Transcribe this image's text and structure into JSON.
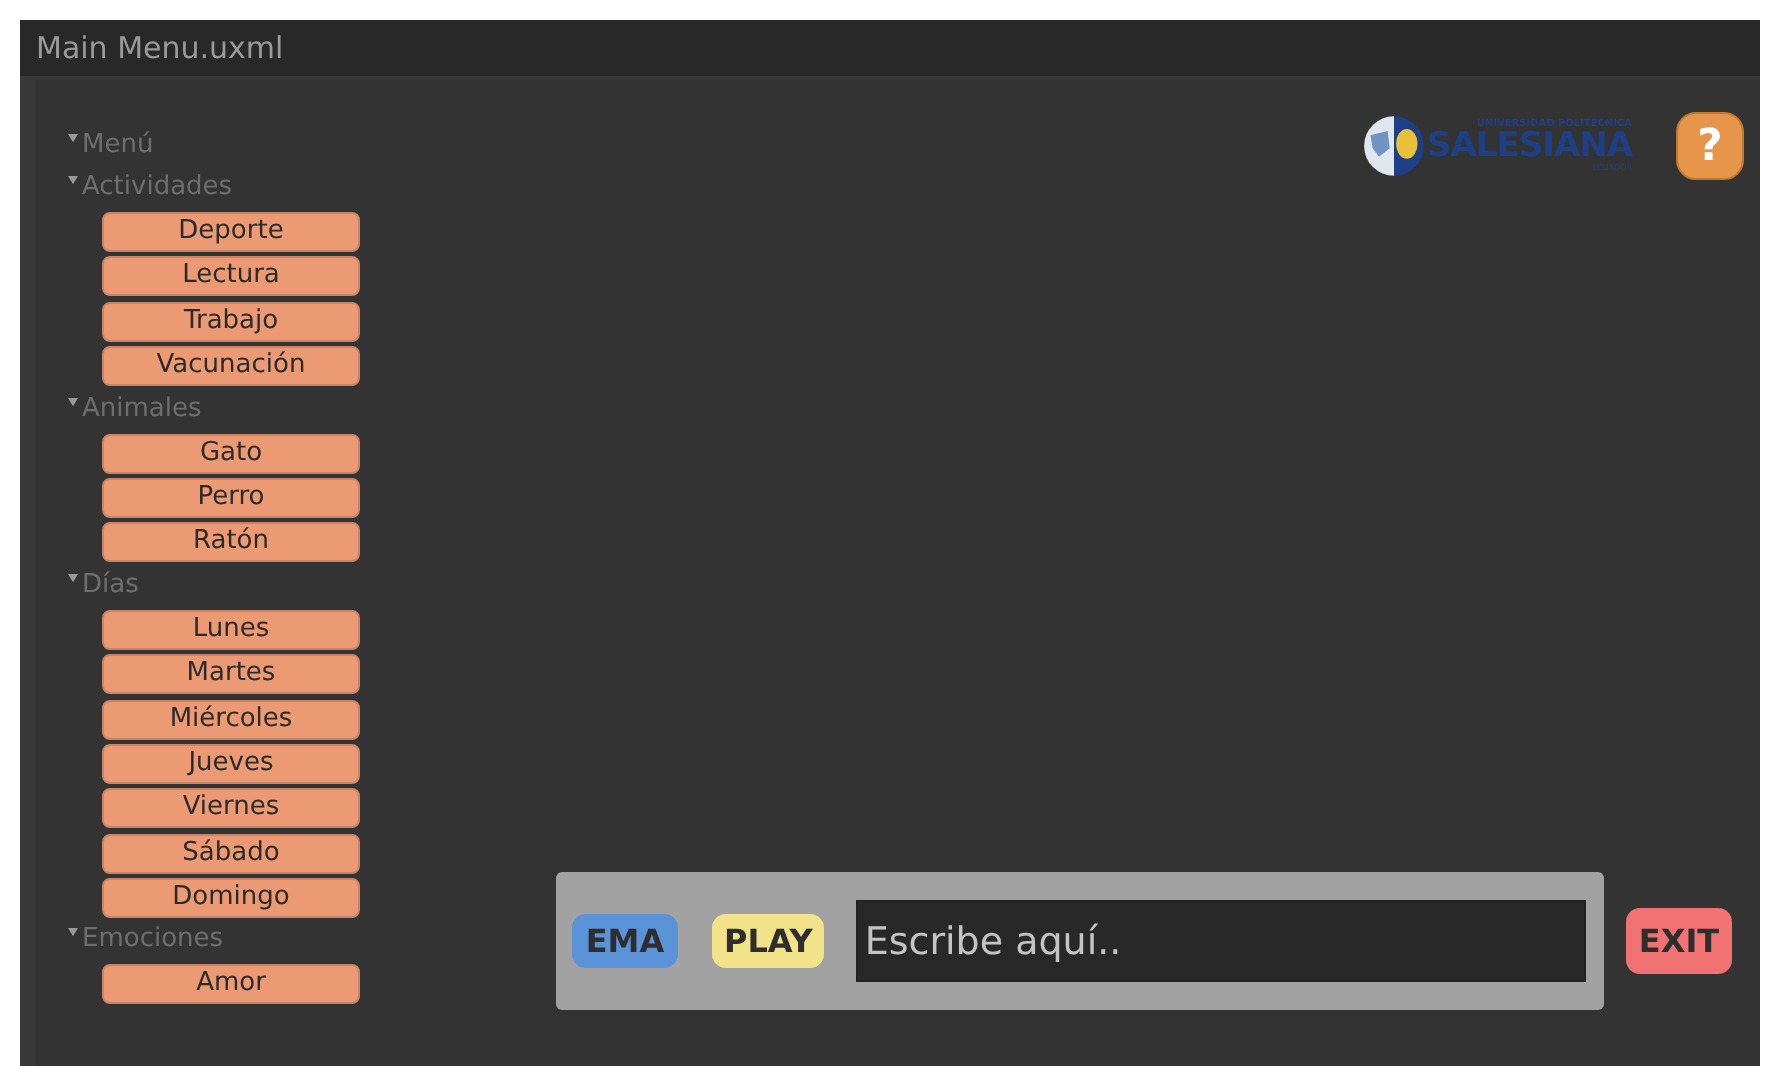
{
  "window": {
    "title": "Main Menu.uxml"
  },
  "tree": {
    "label": "Menú",
    "expanded": true,
    "children": [
      {
        "label": "Actividades",
        "expanded": true,
        "buttons": [
          "Deporte",
          "Lectura",
          "Trabajo",
          "Vacunación"
        ]
      },
      {
        "label": "Animales",
        "expanded": true,
        "buttons": [
          "Gato",
          "Perro",
          "Ratón"
        ]
      },
      {
        "label": "Días",
        "expanded": true,
        "buttons": [
          "Lunes",
          "Martes",
          "Miércoles",
          "Jueves",
          "Viernes",
          "Sábado",
          "Domingo"
        ]
      },
      {
        "label": "Emociones",
        "expanded": true,
        "buttons": [
          "Amor"
        ]
      }
    ]
  },
  "logo": {
    "top_line": "UNIVERSIDAD POLITÉCNICA",
    "name": "SALESIANA",
    "bottom_line": "ECUADOR"
  },
  "help_button": {
    "label": "?"
  },
  "bottom_bar": {
    "buttons": [
      {
        "label": "EMA",
        "color": "#5b93d9"
      },
      {
        "label": "PLAY",
        "color": "#f2e38a"
      }
    ],
    "input": {
      "placeholder": "Escribe aquí.."
    }
  },
  "exit_button": {
    "label": "EXIT",
    "color": "#f07272"
  }
}
